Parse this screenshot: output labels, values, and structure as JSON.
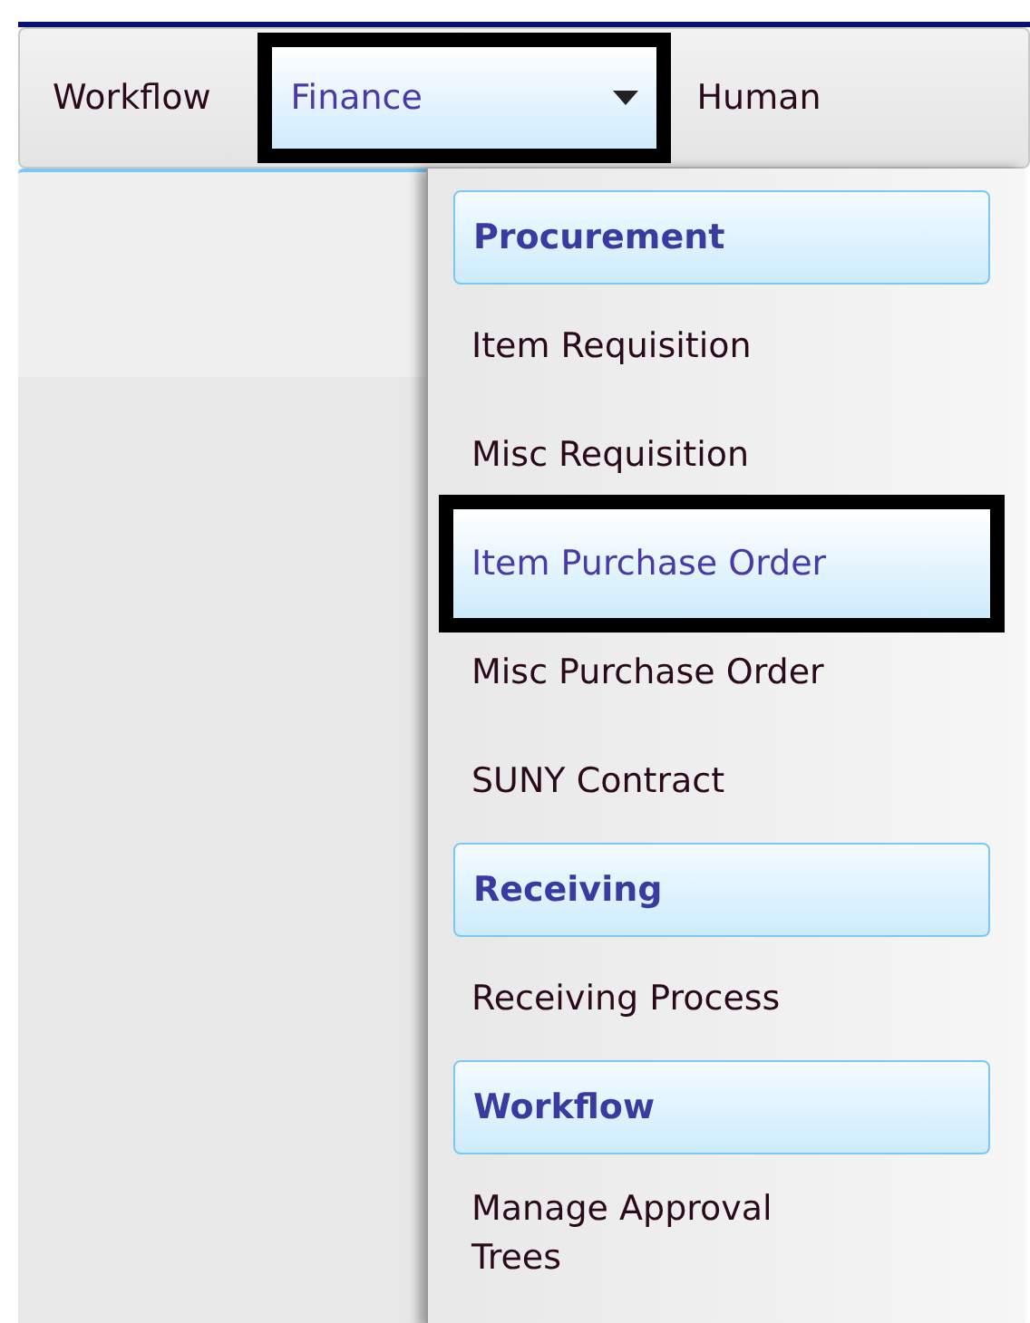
{
  "menu_bar": [
    {
      "label": "Workflow",
      "selected": false,
      "has_dropdown": false,
      "outlined": false
    },
    {
      "label": "Finance",
      "selected": true,
      "has_dropdown": true,
      "outlined": true
    },
    {
      "label": "Human",
      "selected": false,
      "has_dropdown": false,
      "outlined": false
    }
  ],
  "dropdown": [
    {
      "kind": "header",
      "label": "Procurement",
      "selected": false,
      "outlined": false
    },
    {
      "kind": "item",
      "label": "Item Requisition",
      "selected": false,
      "outlined": false
    },
    {
      "kind": "item",
      "label": "Misc Requisition",
      "selected": false,
      "outlined": false
    },
    {
      "kind": "item",
      "label": "Item Purchase Order",
      "selected": true,
      "outlined": true
    },
    {
      "kind": "item",
      "label": "Misc Purchase Order",
      "selected": false,
      "outlined": false
    },
    {
      "kind": "item",
      "label": "SUNY Contract",
      "selected": false,
      "outlined": false
    },
    {
      "kind": "header",
      "label": "Receiving",
      "selected": false,
      "outlined": false
    },
    {
      "kind": "item",
      "label": "Receiving Process",
      "selected": false,
      "outlined": false
    },
    {
      "kind": "header",
      "label": "Workflow",
      "selected": false,
      "outlined": false
    },
    {
      "kind": "item",
      "label": "Manage Approval Trees",
      "selected": false,
      "outlined": false
    }
  ]
}
